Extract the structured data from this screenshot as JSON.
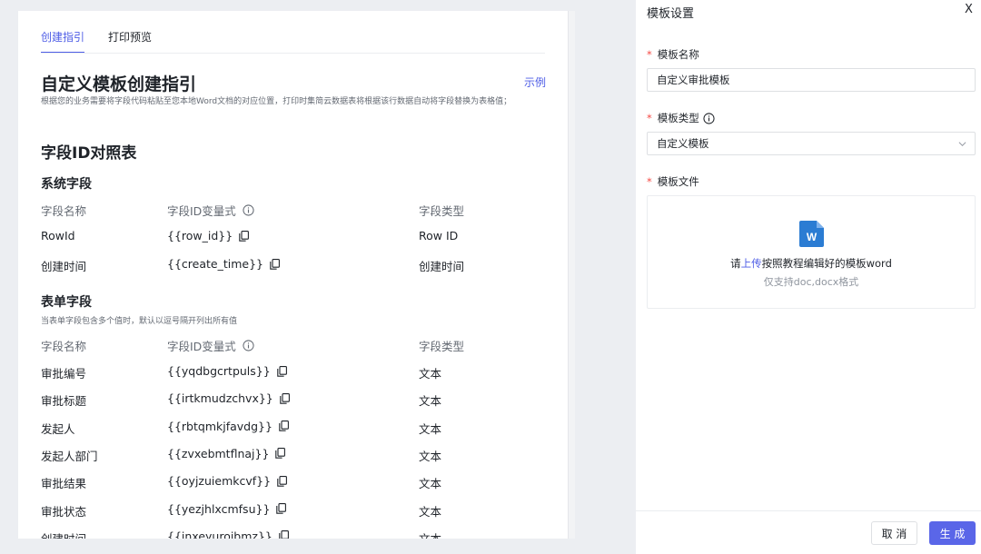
{
  "tabs": [
    {
      "label": "创建指引",
      "active": true
    },
    {
      "label": "打印预览",
      "active": false
    }
  ],
  "guide": {
    "title": "自定义模板创建指引",
    "example_link": "示例",
    "description": "根据您的业务需要将字段代码粘贴至您本地Word文档的对应位置，打印时集简云数据表将根据该行数据自动将字段替换为表格值；"
  },
  "field_table_title": "字段ID对照表",
  "columns": {
    "name": "字段名称",
    "var": "字段ID变量式",
    "type": "字段类型"
  },
  "system_fields": {
    "title": "系统字段",
    "rows": [
      {
        "name": "RowId",
        "var": "{{row_id}}",
        "type": "Row ID"
      },
      {
        "name": "创建时间",
        "var": "{{create_time}}",
        "type": "创建时间"
      }
    ]
  },
  "form_fields": {
    "title": "表单字段",
    "note": "当表单字段包含多个值时，默认以逗号隔开列出所有值",
    "rows": [
      {
        "name": "审批编号",
        "var": "{{yqdbgcrtpuls}}",
        "type": "文本"
      },
      {
        "name": "审批标题",
        "var": "{{irtkmudzchvx}}",
        "type": "文本"
      },
      {
        "name": "发起人",
        "var": "{{rbtqmkjfavdg}}",
        "type": "文本"
      },
      {
        "name": "发起人部门",
        "var": "{{zvxebmtflnaj}}",
        "type": "文本"
      },
      {
        "name": "审批结果",
        "var": "{{oyjzuiemkcvf}}",
        "type": "文本"
      },
      {
        "name": "审批状态",
        "var": "{{yezjhlxcmfsu}}",
        "type": "文本"
      },
      {
        "name": "创建时间",
        "var": "{{inxeyuroibmz}}",
        "type": "文本"
      }
    ]
  },
  "panel": {
    "title": "模板设置",
    "close": "X",
    "name_label": "模板名称",
    "name_value": "自定义审批模板",
    "type_label": "模板类型",
    "type_value": "自定义模板",
    "file_label": "模板文件",
    "upload_prefix": "请",
    "upload_link": "上传",
    "upload_suffix": "按照教程编辑好的模板word",
    "upload_hint": "仅支持doc,docx格式",
    "cancel_label": "取 消",
    "generate_label": "生 成"
  },
  "colors": {
    "accent": "#4e5de6",
    "required": "#f54a45",
    "word_blue": "#2b7cd3"
  }
}
